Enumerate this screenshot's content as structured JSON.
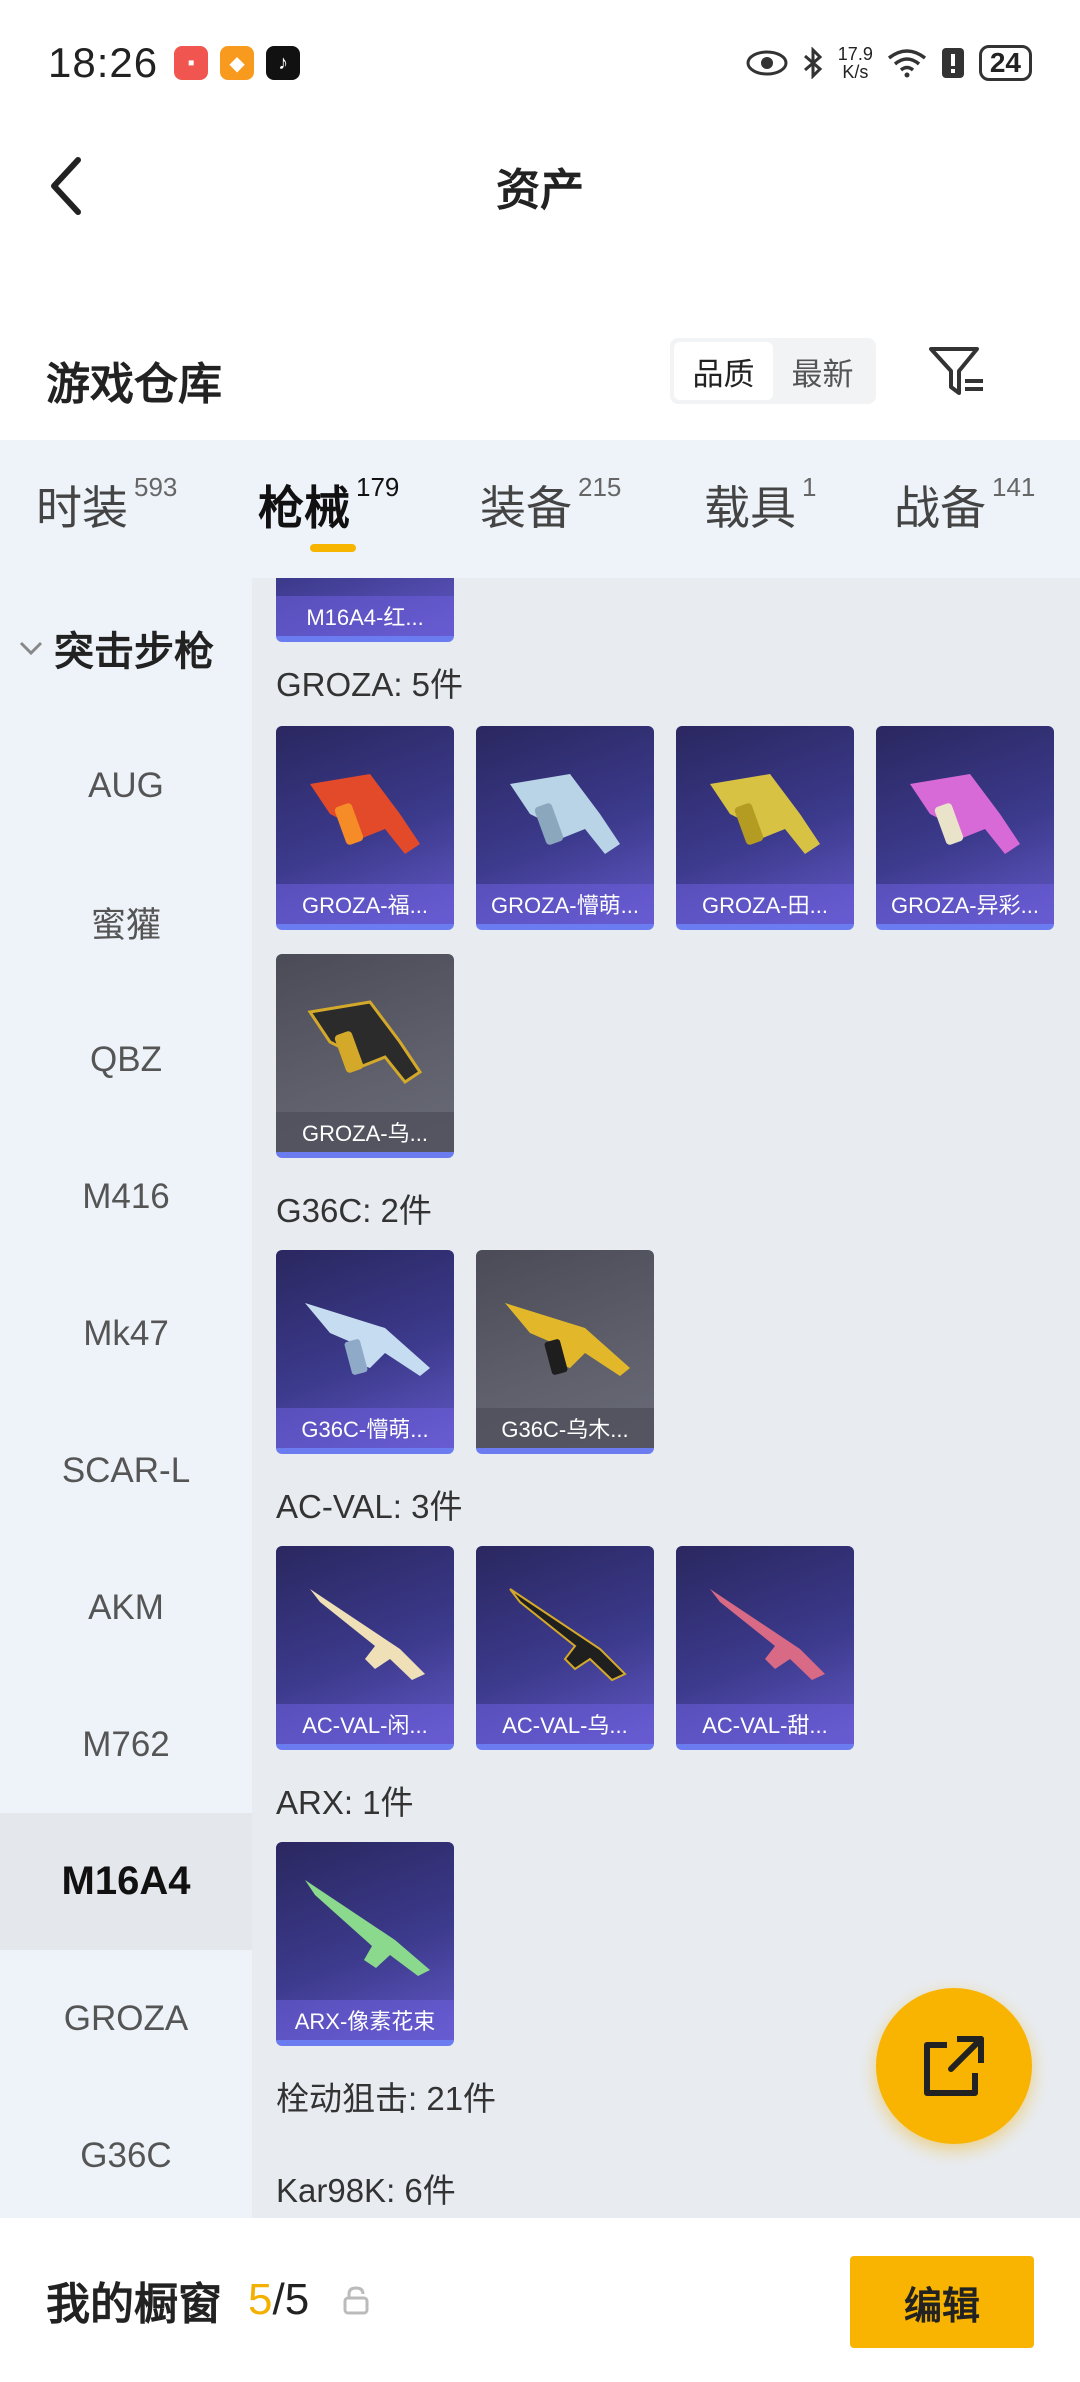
{
  "status_bar": {
    "time": "18:26",
    "speed_value": "17.9",
    "speed_unit": "K/s",
    "battery": "24"
  },
  "app_bar": {
    "title": "资产"
  },
  "section": {
    "title": "游戏仓库",
    "sort_options": [
      "品质",
      "最新"
    ],
    "active_sort": "品质"
  },
  "tabs": [
    {
      "label": "时装",
      "count": "593"
    },
    {
      "label": "枪械",
      "count": "179"
    },
    {
      "label": "装备",
      "count": "215"
    },
    {
      "label": "载具",
      "count": "1"
    },
    {
      "label": "战备",
      "count": "141"
    }
  ],
  "active_tab": "枪械",
  "sidebar": {
    "group": "突击步枪",
    "items": [
      "AUG",
      "蜜獾",
      "QBZ",
      "M416",
      "Mk47",
      "SCAR-L",
      "AKM",
      "M762",
      "M16A4",
      "GROZA",
      "G36C"
    ],
    "active": "M16A4"
  },
  "content": {
    "partial_card": "M16A4-红...",
    "groups": [
      {
        "title": "GROZA: 5件",
        "items": [
          {
            "label": "GROZA-福...",
            "tone": "purple"
          },
          {
            "label": "GROZA-懵萌...",
            "tone": "purple"
          },
          {
            "label": "GROZA-田...",
            "tone": "purple"
          },
          {
            "label": "GROZA-异彩...",
            "tone": "purple"
          },
          {
            "label": "GROZA-乌...",
            "tone": "gray"
          }
        ]
      },
      {
        "title": "G36C: 2件",
        "items": [
          {
            "label": "G36C-懵萌...",
            "tone": "purple"
          },
          {
            "label": "G36C-乌木...",
            "tone": "gray"
          }
        ]
      },
      {
        "title": "AC-VAL: 3件",
        "items": [
          {
            "label": "AC-VAL-闲...",
            "tone": "purple"
          },
          {
            "label": "AC-VAL-乌...",
            "tone": "purple"
          },
          {
            "label": "AC-VAL-甜...",
            "tone": "purple"
          }
        ]
      },
      {
        "title": "ARX: 1件",
        "items": [
          {
            "label": "ARX-像素花束",
            "tone": "purple"
          }
        ]
      }
    ],
    "more_groups": [
      "栓动狙击: 21件",
      "Kar98K: 6件"
    ]
  },
  "bottom_bar": {
    "title": "我的橱窗",
    "used": "5",
    "separator": "/",
    "total": "5",
    "edit_label": "编辑"
  },
  "colors": {
    "accent": "#f8b400",
    "card_purple": "#3c3a8c",
    "card_gray": "#5f606c",
    "sidebar_bg": "#eef3f9"
  },
  "icons": [
    "back-arrow-icon",
    "filter-icon",
    "share-external-icon",
    "lock-icon",
    "chevron-down-icon",
    "eye-icon",
    "bluetooth-icon",
    "wifi-icon",
    "alert-icon"
  ]
}
